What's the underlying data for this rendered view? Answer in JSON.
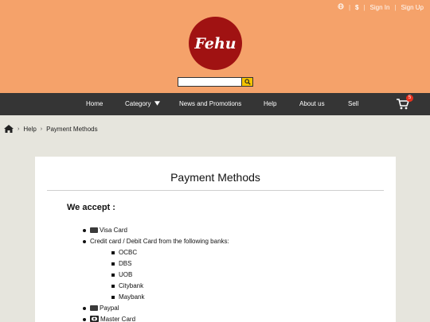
{
  "topbar": {
    "globe_icon": "globe-icon",
    "currency_symbol": "$",
    "sign_in": "Sign In",
    "sign_up": "Sign Up"
  },
  "logo": {
    "text": "Fehu"
  },
  "search": {
    "placeholder": "",
    "icon": "search-icon"
  },
  "nav": {
    "home": "Home",
    "category": "Category",
    "news": "News and Promotions",
    "help": "Help",
    "about": "About us",
    "sell": "Sell",
    "cart_count": "5"
  },
  "breadcrumb": {
    "home_icon": "home-icon",
    "help": "Help",
    "current": "Payment Methods"
  },
  "main": {
    "title": "Payment Methods",
    "subtitle": "We accept :",
    "items": {
      "visa": "Visa Card",
      "credit": "Credit card / Debit Card from the following banks:",
      "banks": [
        "OCBC",
        "DBS",
        "UOB",
        "Citybank",
        "Maybank"
      ],
      "paypal": "Paypal",
      "master": "Master Card"
    }
  },
  "colors": {
    "header_bg": "#f5a26a",
    "logo_bg": "#a01212",
    "nav_bg": "#353535",
    "search_button": "#f4c300",
    "badge": "#e8321e",
    "page_bg": "#e6e5dd"
  }
}
